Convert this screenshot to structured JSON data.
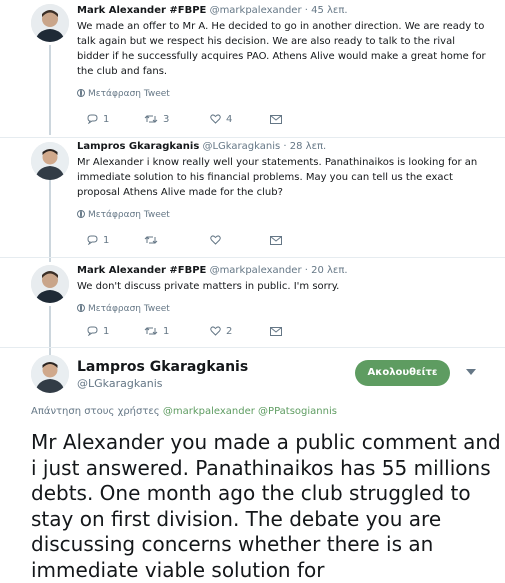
{
  "tweets": [
    {
      "name": "Mark Alexander #FBPE",
      "handle": "@markpalexander",
      "time": "· 45 λεπ.",
      "text": "We made an offer to Mr A. He decided to go in another direction. We are ready to talk again but we respect his decision. We are also ready to talk to the rival bidder if he successfully acquires PAO. Athens Alive would make a great home for the club and fans.",
      "translate": "Μετάφραση Tweet",
      "replies": "1",
      "retweets": "3",
      "likes": "4"
    },
    {
      "name": "Lampros Gkaragkanis",
      "handle": "@LGkaragkanis",
      "time": "· 28 λεπ.",
      "text": "Mr Alexander i know really well your statements. Panathinaikos is looking for an immediate solution to his financial problems. May you can tell us the exact proposal Athens Alive made for the club?",
      "translate": "Μετάφραση Tweet",
      "replies": "1",
      "retweets": "",
      "likes": ""
    },
    {
      "name": "Mark Alexander #FBPE",
      "handle": "@markpalexander",
      "time": "· 20 λεπ.",
      "text": "We don't discuss private matters in public. I'm sorry.",
      "translate": "Μετάφραση Tweet",
      "replies": "1",
      "retweets": "1",
      "likes": "2"
    }
  ],
  "main": {
    "name": "Lampros Gkaragkanis",
    "handle": "@LGkaragkanis",
    "follow_label": "Ακολουθείτε",
    "reply_prefix": "Απάντηση στους χρήστες",
    "mention1": "@markpalexander",
    "mention2": "@PPatsogiannis",
    "text": "Mr Alexander you made a public comment and i just answered. Panathinaikos has 55 millions debts. One month ago the club struggled to stay on first division. The debate you are discussing concerns whether there is an immediate viable solution for"
  },
  "colors": {
    "follow_button": "#5e9c61",
    "secondary_text": "#657786",
    "mention": "#5e9c61"
  }
}
